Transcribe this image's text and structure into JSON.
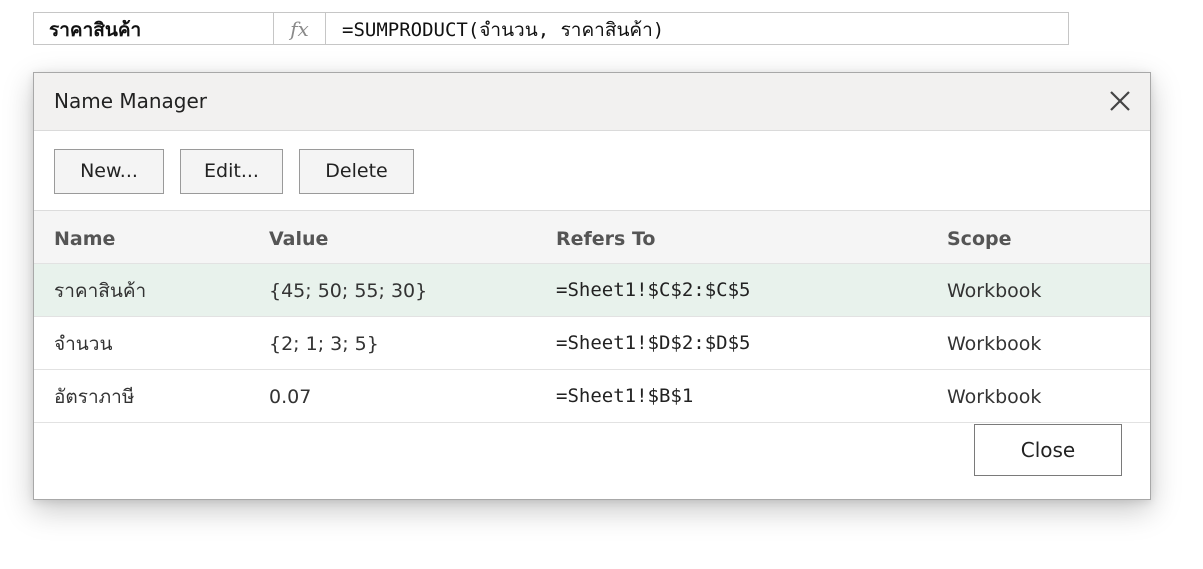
{
  "formula_bar": {
    "name_box": "ราคาสินค้า",
    "fx_label": "fx",
    "formula": "=SUMPRODUCT(จำนวน, ราคาสินค้า)"
  },
  "dialog": {
    "title": "Name Manager",
    "close_icon": "close-icon",
    "toolbar": {
      "new_label": "New...",
      "edit_label": "Edit...",
      "delete_label": "Delete"
    },
    "columns": [
      "Name",
      "Value",
      "Refers To",
      "Scope"
    ],
    "rows": [
      {
        "name": "ราคาสินค้า",
        "value": "{45; 50; 55; 30}",
        "refers_to": "=Sheet1!$C$2:$C$5",
        "scope": "Workbook",
        "selected": true
      },
      {
        "name": "จำนวน",
        "value": "{2; 1; 3; 5}",
        "refers_to": "=Sheet1!$D$2:$D$5",
        "scope": "Workbook",
        "selected": false
      },
      {
        "name": "อัตราภาษี",
        "value": "0.07",
        "refers_to": "=Sheet1!$B$1",
        "scope": "Workbook",
        "selected": false
      }
    ],
    "close_label": "Close"
  },
  "colors": {
    "selected_row": "#e8f2ec",
    "titlebar": "#f2f1f0",
    "header_row": "#f5f5f5"
  }
}
